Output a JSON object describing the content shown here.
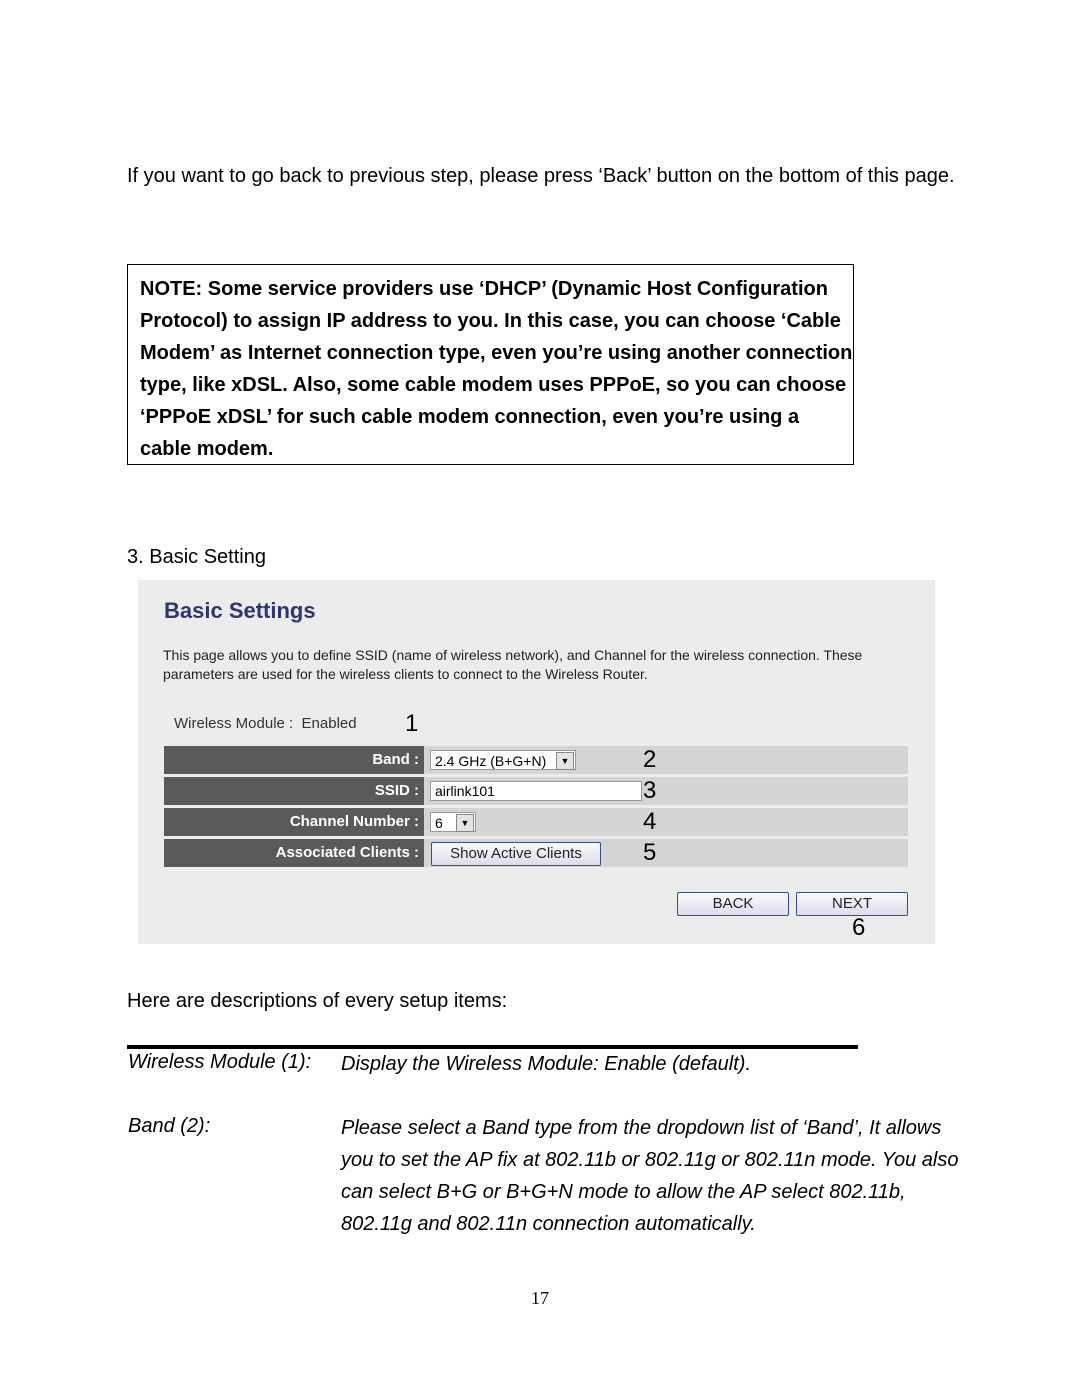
{
  "intro": "If you want to go back to previous step, please press ‘Back’ button on the bottom of this page.",
  "note": "NOTE: Some service providers use ‘DHCP’ (Dynamic Host Configuration Protocol) to assign IP address to you. In this case, you can choose ‘Cable Modem’ as Internet connection type, even you’re using another connection type, like xDSL. Also, some cable modem uses PPPoE, so you can choose ‘PPPoE xDSL’ for such cable modem connection, even you’re using a cable modem.",
  "section_heading": "3. Basic Setting",
  "screenshot": {
    "title": "Basic Settings",
    "description": "This page allows you to define SSID (name of wireless network), and Channel for the wireless connection. These parameters are used for the wireless clients to connect to the Wireless Router.",
    "wireless_module_label": "Wireless Module :",
    "wireless_module_value": "Enabled",
    "band_label": "Band :",
    "band_value": "2.4 GHz (B+G+N)",
    "ssid_label": "SSID :",
    "ssid_value": "airlink101",
    "channel_label": "Channel Number :",
    "channel_value": "6",
    "clients_label": "Associated Clients :",
    "clients_button": "Show Active Clients",
    "back": "BACK",
    "next": "NEXT",
    "callouts": [
      "1",
      "2",
      "3",
      "4",
      "5",
      "6"
    ]
  },
  "descriptions_heading": "Here are descriptions of every setup items:",
  "items": [
    {
      "label": "Wireless Module (1):",
      "text": "Display the Wireless Module: Enable (default)."
    },
    {
      "label": "Band (2):",
      "text": "Please select a Band type from the dropdown list of ‘Band’, It allows you to set the AP fix at 802.11b or 802.11g or 802.11n mode. You also can select B+G or B+G+N mode to allow the AP select 802.11b, 802.11g and 802.11n connection automatically."
    }
  ],
  "page_number": "17"
}
